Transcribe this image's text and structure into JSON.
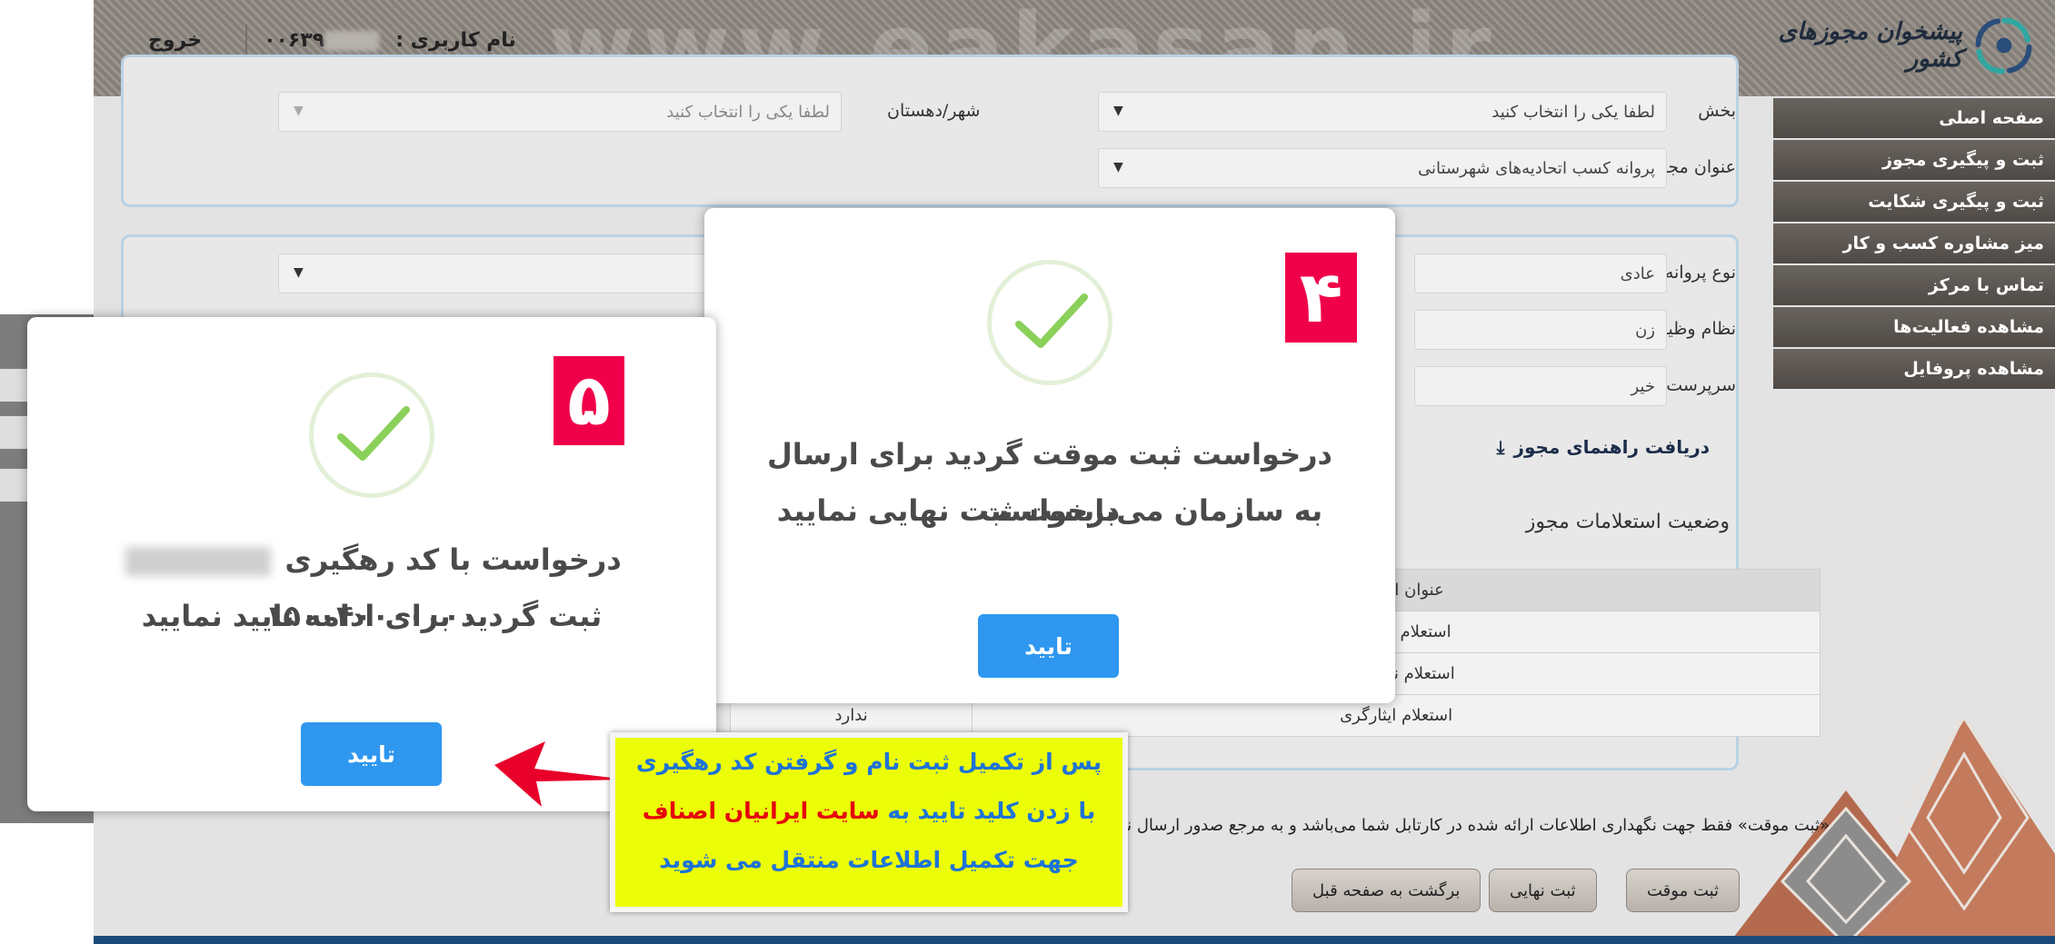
{
  "header": {
    "watermark": "www.eakasan.ir",
    "username_label": "نام کاربری :",
    "username_prefix": "۰۰۶۳۹",
    "logout": "خروج",
    "logo_text": "پیشخوان مجوزهای کشور"
  },
  "sidebar": {
    "items": [
      {
        "label": "صفحه اصلی"
      },
      {
        "label": "ثبت و پیگیری مجوز"
      },
      {
        "label": "ثبت و پیگیری شکایت"
      },
      {
        "label": "میز مشاوره کسب و کار"
      },
      {
        "label": "تماس با مرکز"
      },
      {
        "label": "مشاهده فعالیت‌ها"
      },
      {
        "label": "مشاهده پروفایل"
      }
    ]
  },
  "form": {
    "section_label": "بخش",
    "section_value": "لطفا یکی را انتخاب کنید",
    "city_label": "شهر/دهستان",
    "city_value": "لطفا یکی را انتخاب کنید",
    "license_title_label": "عنوان مجوز",
    "license_title_value": "پروانه کسب اتحادیه‌های شهرستانی",
    "license_type_label": "نوع پروانه کسب",
    "license_type_value": "عادی",
    "military_label": "نظام وظیفه",
    "military_value": "زن",
    "head_label": "سرپرست خانواده",
    "head_value": "خیر",
    "guide_link": "دریافت راهنمای مجوز",
    "inquiry_status": "وضعیت استعلامات مجوز"
  },
  "inquiry_table": {
    "header": [
      "عنوان استعلام",
      ""
    ],
    "rows": [
      [
        "استعلام ثبت احو",
        ""
      ],
      [
        "استعلام نظام وظ",
        ""
      ],
      [
        "استعلام ایثارگری",
        "ندارد"
      ]
    ]
  },
  "note": "«ثبت موقت» فقط جهت نگهداری اطلاعات ارائه شده در کارتابل شما می‌باشد و به مرجع صدور ارسال نمی‌گردد. پس از تکمیل اطلاعات باید بر روی دکمه «ثبت نهایی» کلیک نمایید.",
  "buttons": {
    "temp_save": "ثبت موقت",
    "final_save": "ثبت نهایی",
    "back": "برگشت به صفحه قبل"
  },
  "modal4": {
    "badge": "۴",
    "line1": "درخواست ثبت موقت گردید برای ارسال درخواست",
    "line2": "به سازمان می‌بایست ثبت نهایی نمایید",
    "confirm": "تایید"
  },
  "modal5": {
    "badge": "۵",
    "line1_pre": "درخواست با کد رهگیری",
    "line1_code": "۱۵۰۰۴۰۰۰۰۰۰۰",
    "line2": "ثبت گردید برای ادامه تایید نمایید",
    "confirm": "تایید"
  },
  "callout": {
    "line1": "پس از تکمیل ثبت نام و گرفتن کد رهگیری",
    "line2_a": "با زدن کلید تایید به",
    "line2_b": "سایت ایرانیان اصناف",
    "line3": "جهت تکمیل اطلاعات منتقل می شوید"
  },
  "colors": {
    "accent_blue": "#2f97ef",
    "badge_red": "#f0004a",
    "callout_yellow": "#ecfd08",
    "callout_text": "#1f73d6",
    "callout_red": "#e5000c"
  }
}
